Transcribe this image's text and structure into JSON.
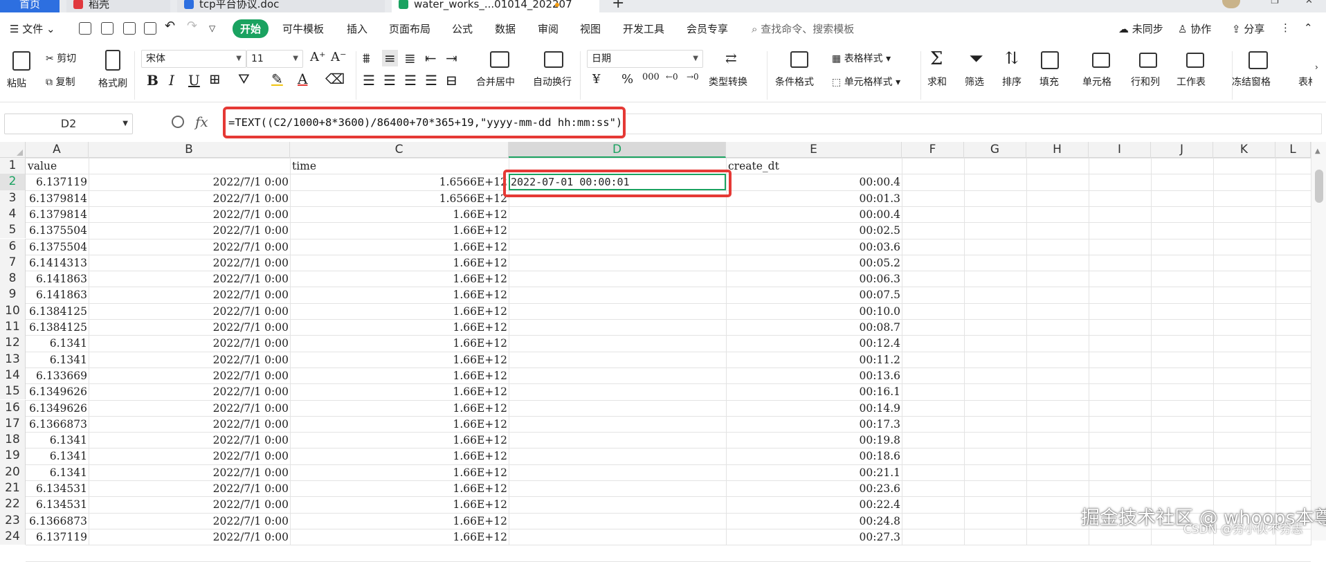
{
  "tabs": {
    "home": "首页",
    "t1": "稻壳",
    "t2": "tcp平台协议.doc",
    "t3": "water_works_...01014_202207"
  },
  "menu": {
    "file": "文件",
    "start": "开始",
    "items": [
      "可牛模板",
      "插入",
      "页面布局",
      "公式",
      "数据",
      "审阅",
      "视图",
      "开发工具",
      "会员专享"
    ],
    "search": "查找命令、搜索模板",
    "sync": "未同步",
    "collab": "协作",
    "share": "分享"
  },
  "ribbon": {
    "paste": "粘贴",
    "cut": "剪切",
    "copy": "复制",
    "format_painter": "格式刷",
    "font_name": "宋体",
    "font_size": "11",
    "merge_center": "合并居中",
    "wrap": "自动换行",
    "number_format": "日期",
    "type_convert": "类型转换",
    "cond_format": "条件格式",
    "table_style": "表格样式",
    "cell_style": "单元格样式",
    "sum": "求和",
    "filter": "筛选",
    "sort": "排序",
    "fill": "填充",
    "cells": "单元格",
    "rowcol": "行和列",
    "sheet": "工作表",
    "freeze": "冻结窗格",
    "table_tools": "表格"
  },
  "formula_bar": {
    "name_box": "D2",
    "fx": "fx",
    "formula": "=TEXT((C2/1000+8*3600)/86400+70*365+19,\"yyyy-mm-dd hh:mm:ss\")"
  },
  "sheet": {
    "active_cell": "D2",
    "columns": [
      "A",
      "B",
      "C",
      "D",
      "E",
      "F",
      "G",
      "H",
      "I",
      "J",
      "K",
      "L"
    ],
    "header_row": {
      "A": "value",
      "B": "",
      "C": "time",
      "D": "",
      "E": "create_dt"
    },
    "rows": [
      {
        "n": "2",
        "A": "6.137119",
        "B": "2022/7/1 0:00",
        "C": "1.6566E+12",
        "D": "2022-07-01 00:00:01",
        "E": "00:00.4"
      },
      {
        "n": "3",
        "A": "6.1379814",
        "B": "2022/7/1 0:00",
        "C": "1.6566E+12",
        "D": "",
        "E": "00:01.3"
      },
      {
        "n": "4",
        "A": "6.1379814",
        "B": "2022/7/1 0:00",
        "C": "1.66E+12",
        "D": "",
        "E": "00:00.4"
      },
      {
        "n": "5",
        "A": "6.1375504",
        "B": "2022/7/1 0:00",
        "C": "1.66E+12",
        "D": "",
        "E": "00:02.5"
      },
      {
        "n": "6",
        "A": "6.1375504",
        "B": "2022/7/1 0:00",
        "C": "1.66E+12",
        "D": "",
        "E": "00:03.6"
      },
      {
        "n": "7",
        "A": "6.1414313",
        "B": "2022/7/1 0:00",
        "C": "1.66E+12",
        "D": "",
        "E": "00:05.2"
      },
      {
        "n": "8",
        "A": "6.141863",
        "B": "2022/7/1 0:00",
        "C": "1.66E+12",
        "D": "",
        "E": "00:06.3"
      },
      {
        "n": "9",
        "A": "6.141863",
        "B": "2022/7/1 0:00",
        "C": "1.66E+12",
        "D": "",
        "E": "00:07.5"
      },
      {
        "n": "10",
        "A": "6.1384125",
        "B": "2022/7/1 0:00",
        "C": "1.66E+12",
        "D": "",
        "E": "00:10.0"
      },
      {
        "n": "11",
        "A": "6.1384125",
        "B": "2022/7/1 0:00",
        "C": "1.66E+12",
        "D": "",
        "E": "00:08.7"
      },
      {
        "n": "12",
        "A": "6.1341",
        "B": "2022/7/1 0:00",
        "C": "1.66E+12",
        "D": "",
        "E": "00:12.4"
      },
      {
        "n": "13",
        "A": "6.1341",
        "B": "2022/7/1 0:00",
        "C": "1.66E+12",
        "D": "",
        "E": "00:11.2"
      },
      {
        "n": "14",
        "A": "6.133669",
        "B": "2022/7/1 0:00",
        "C": "1.66E+12",
        "D": "",
        "E": "00:13.6"
      },
      {
        "n": "15",
        "A": "6.1349626",
        "B": "2022/7/1 0:00",
        "C": "1.66E+12",
        "D": "",
        "E": "00:16.1"
      },
      {
        "n": "16",
        "A": "6.1349626",
        "B": "2022/7/1 0:00",
        "C": "1.66E+12",
        "D": "",
        "E": "00:14.9"
      },
      {
        "n": "17",
        "A": "6.1366873",
        "B": "2022/7/1 0:00",
        "C": "1.66E+12",
        "D": "",
        "E": "00:17.3"
      },
      {
        "n": "18",
        "A": "6.1341",
        "B": "2022/7/1 0:00",
        "C": "1.66E+12",
        "D": "",
        "E": "00:19.8"
      },
      {
        "n": "19",
        "A": "6.1341",
        "B": "2022/7/1 0:00",
        "C": "1.66E+12",
        "D": "",
        "E": "00:18.6"
      },
      {
        "n": "20",
        "A": "6.1341",
        "B": "2022/7/1 0:00",
        "C": "1.66E+12",
        "D": "",
        "E": "00:21.1"
      },
      {
        "n": "21",
        "A": "6.134531",
        "B": "2022/7/1 0:00",
        "C": "1.66E+12",
        "D": "",
        "E": "00:23.6"
      },
      {
        "n": "22",
        "A": "6.134531",
        "B": "2022/7/1 0:00",
        "C": "1.66E+12",
        "D": "",
        "E": "00:22.4"
      },
      {
        "n": "23",
        "A": "6.1366873",
        "B": "2022/7/1 0:00",
        "C": "1.66E+12",
        "D": "",
        "E": "00:24.8"
      },
      {
        "n": "24",
        "A": "6.137119",
        "B": "2022/7/1 0:00",
        "C": "1.66E+12",
        "D": "",
        "E": "00:27.3"
      }
    ]
  },
  "watermark": {
    "main": "掘金技术社区 @ whoops本尊",
    "sub": "CSDN @穷小伙不穷志"
  },
  "colors": {
    "accent_green": "#1aa260",
    "highlight_red": "#e53935",
    "home_tab_blue": "#2d6fe0"
  }
}
